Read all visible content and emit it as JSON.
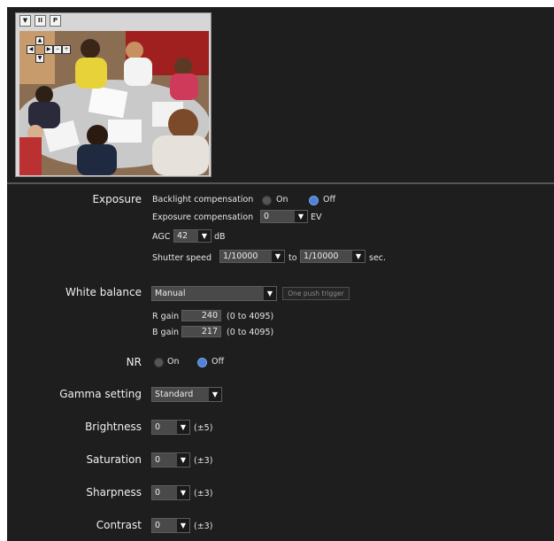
{
  "preview": {
    "toolbar": {
      "menu_icon": "▼",
      "pause_icon": "II",
      "p_label": "P"
    },
    "ptz_icons": [
      "◀",
      "▲",
      "▶",
      "▼",
      "−",
      "+"
    ]
  },
  "exposure": {
    "label": "Exposure",
    "backlight": {
      "label": "Backlight compensation",
      "on_label": "On",
      "off_label": "Off",
      "selected": "Off"
    },
    "compensation": {
      "label": "Exposure compensation",
      "value": "0",
      "unit": "EV"
    },
    "agc": {
      "label": "AGC",
      "value": "42",
      "unit": "dB"
    },
    "shutter": {
      "label": "Shutter speed",
      "from": "1/10000",
      "to_label": "to",
      "to": "1/10000",
      "unit": "sec."
    }
  },
  "white_balance": {
    "label": "White balance",
    "mode": "Manual",
    "push_button": "One push trigger",
    "r_gain": {
      "label": "R gain",
      "value": "240",
      "range": "(0 to 4095)"
    },
    "b_gain": {
      "label": "B gain",
      "value": "217",
      "range": "(0 to 4095)"
    }
  },
  "nr": {
    "label": "NR",
    "on_label": "On",
    "off_label": "Off",
    "selected": "Off"
  },
  "gamma": {
    "label": "Gamma setting",
    "value": "Standard"
  },
  "brightness": {
    "label": "Brightness",
    "value": "0",
    "range": "(±5)"
  },
  "saturation": {
    "label": "Saturation",
    "value": "0",
    "range": "(±3)"
  },
  "sharpness": {
    "label": "Sharpness",
    "value": "0",
    "range": "(±3)"
  },
  "contrast": {
    "label": "Contrast",
    "value": "0",
    "range": "(±3)"
  },
  "colors": {
    "background": "#1e1e1e",
    "radio_selected": "#4d82d9",
    "divider": "#555555"
  }
}
